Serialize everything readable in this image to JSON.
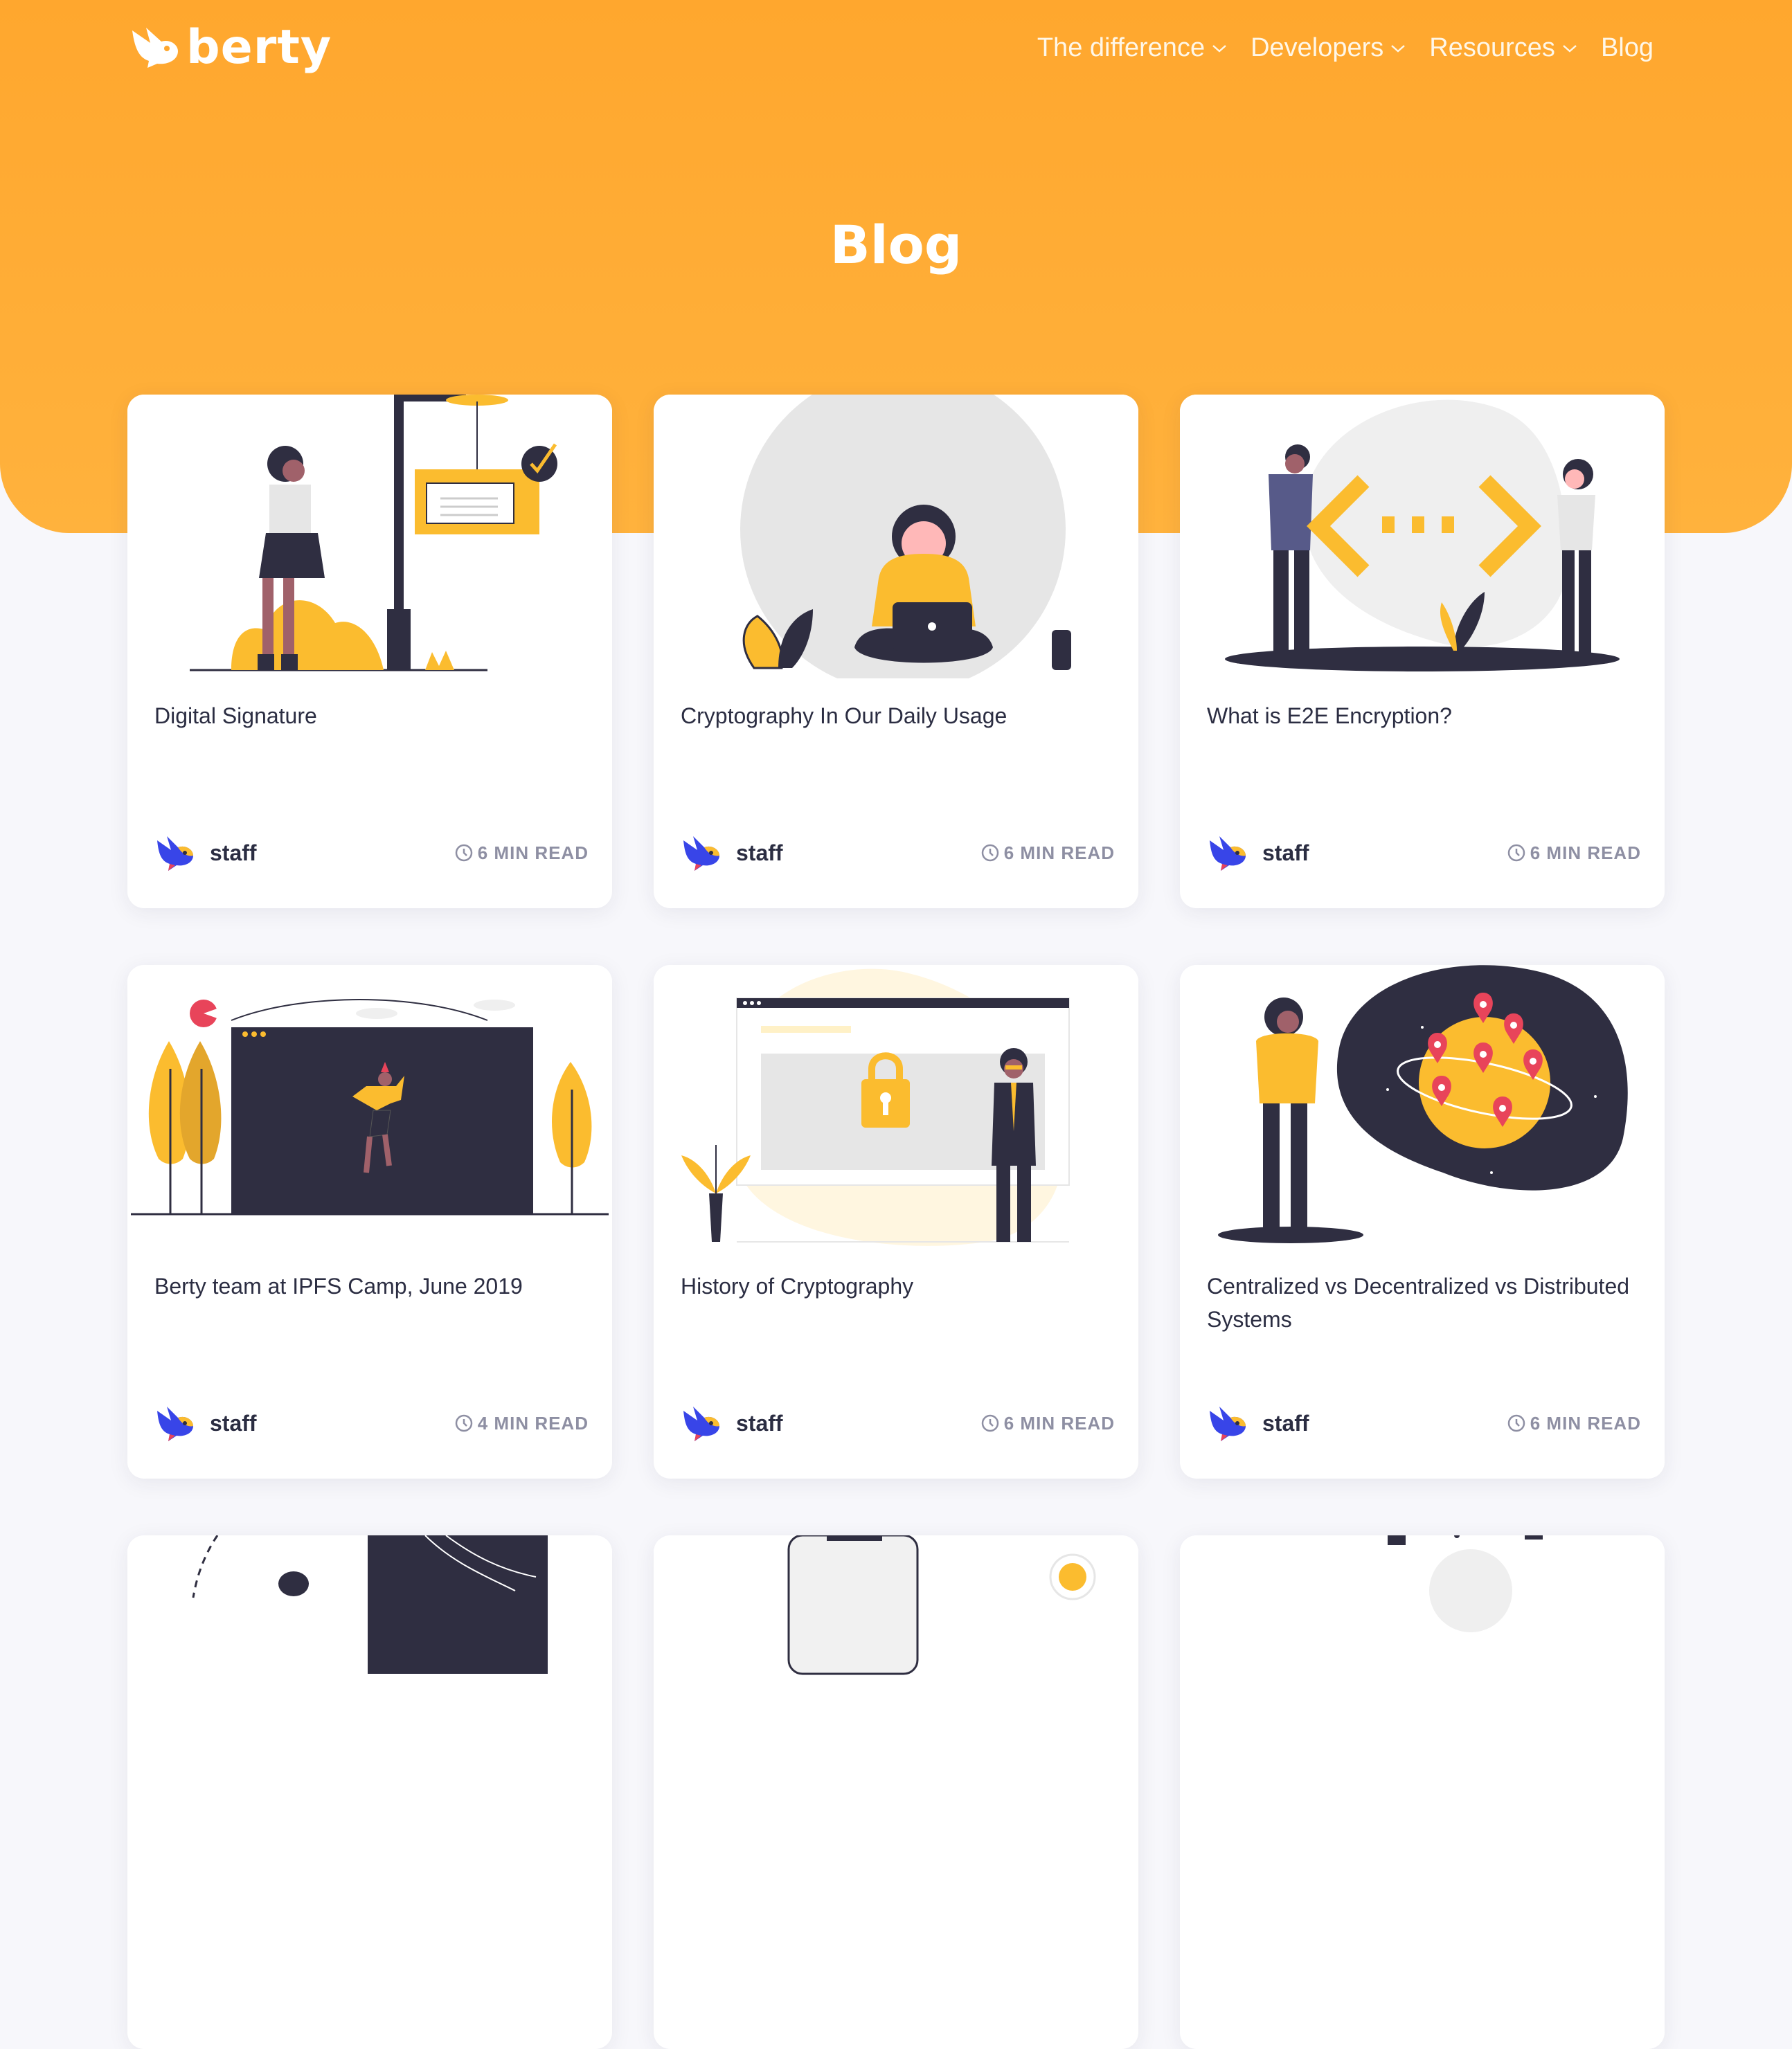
{
  "brand": {
    "name": "berty"
  },
  "nav": {
    "items": [
      {
        "label": "The difference",
        "dropdown": true
      },
      {
        "label": "Developers",
        "dropdown": true
      },
      {
        "label": "Resources",
        "dropdown": true
      },
      {
        "label": "Blog",
        "dropdown": false
      }
    ]
  },
  "hero": {
    "title": "Blog"
  },
  "posts": [
    {
      "title": "Digital Signature",
      "author": "staff",
      "read_time": "6 MIN READ",
      "illustration": "woman-at-signpost"
    },
    {
      "title": "Cryptography In Our Daily Usage",
      "author": "staff",
      "read_time": "6 MIN READ",
      "illustration": "woman-with-laptop"
    },
    {
      "title": "What is E2E Encryption?",
      "author": "staff",
      "read_time": "6 MIN READ",
      "illustration": "two-people-exchange-code"
    },
    {
      "title": "Berty team at IPFS Camp, June 2019",
      "author": "staff",
      "read_time": "4 MIN READ",
      "illustration": "person-on-screen"
    },
    {
      "title": "History of Cryptography",
      "author": "staff",
      "read_time": "6 MIN READ",
      "illustration": "browser-padlock"
    },
    {
      "title": "Centralized vs Decentralized vs Distributed Systems",
      "author": "staff",
      "read_time": "6 MIN READ",
      "illustration": "globe-with-pins"
    }
  ],
  "colors": {
    "accent": "#ffa72e",
    "dark": "#2f2e41",
    "yellow": "#fbbc2f",
    "text": "#2b2d42",
    "muted": "#8e8fa3"
  }
}
